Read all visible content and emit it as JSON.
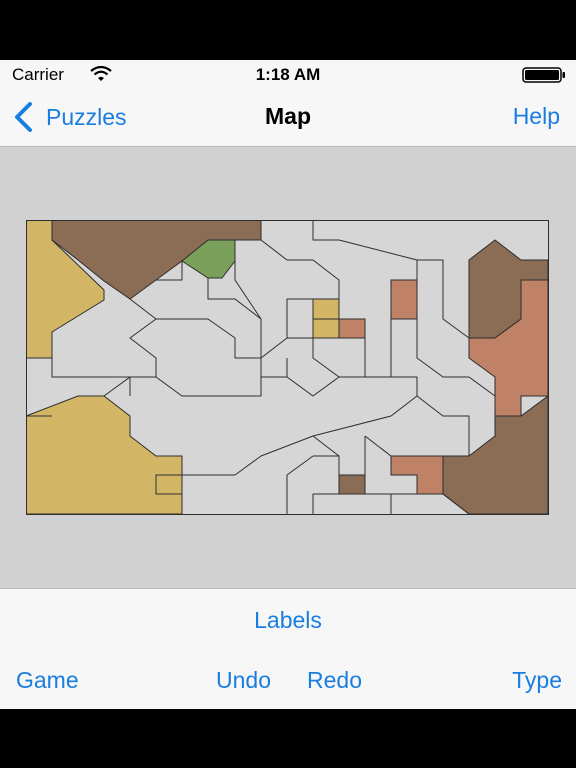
{
  "status_bar": {
    "carrier": "Carrier",
    "time": "1:18 AM",
    "icons": [
      "wifi-icon",
      "battery-icon"
    ]
  },
  "nav": {
    "back_label": "Puzzles",
    "title": "Map",
    "help_label": "Help"
  },
  "toolbar": {
    "labels_label": "Labels",
    "game_label": "Game",
    "undo_label": "Undo",
    "redo_label": "Redo",
    "type_label": "Type"
  },
  "colors": {
    "accent": "#1a7de0",
    "region_empty": "#d6d6d6",
    "region_gold": "#d2b565",
    "region_brown": "#8b6c55",
    "region_green": "#7aa05c",
    "region_terracotta": "#bf8266",
    "border": "#2e2e2e",
    "background": "#d1d1d1"
  },
  "map": {
    "colored_regions": [
      {
        "id": "r1",
        "color": "gold"
      },
      {
        "id": "r2",
        "color": "gold"
      },
      {
        "id": "r3",
        "color": "gold"
      },
      {
        "id": "r4",
        "color": "brown"
      },
      {
        "id": "r5",
        "color": "brown"
      },
      {
        "id": "r6",
        "color": "brown"
      },
      {
        "id": "r7",
        "color": "brown"
      },
      {
        "id": "r8",
        "color": "green"
      },
      {
        "id": "r9",
        "color": "terracotta"
      },
      {
        "id": "r10",
        "color": "terracotta"
      },
      {
        "id": "r11",
        "color": "terracotta"
      },
      {
        "id": "r12",
        "color": "terracotta"
      }
    ]
  }
}
